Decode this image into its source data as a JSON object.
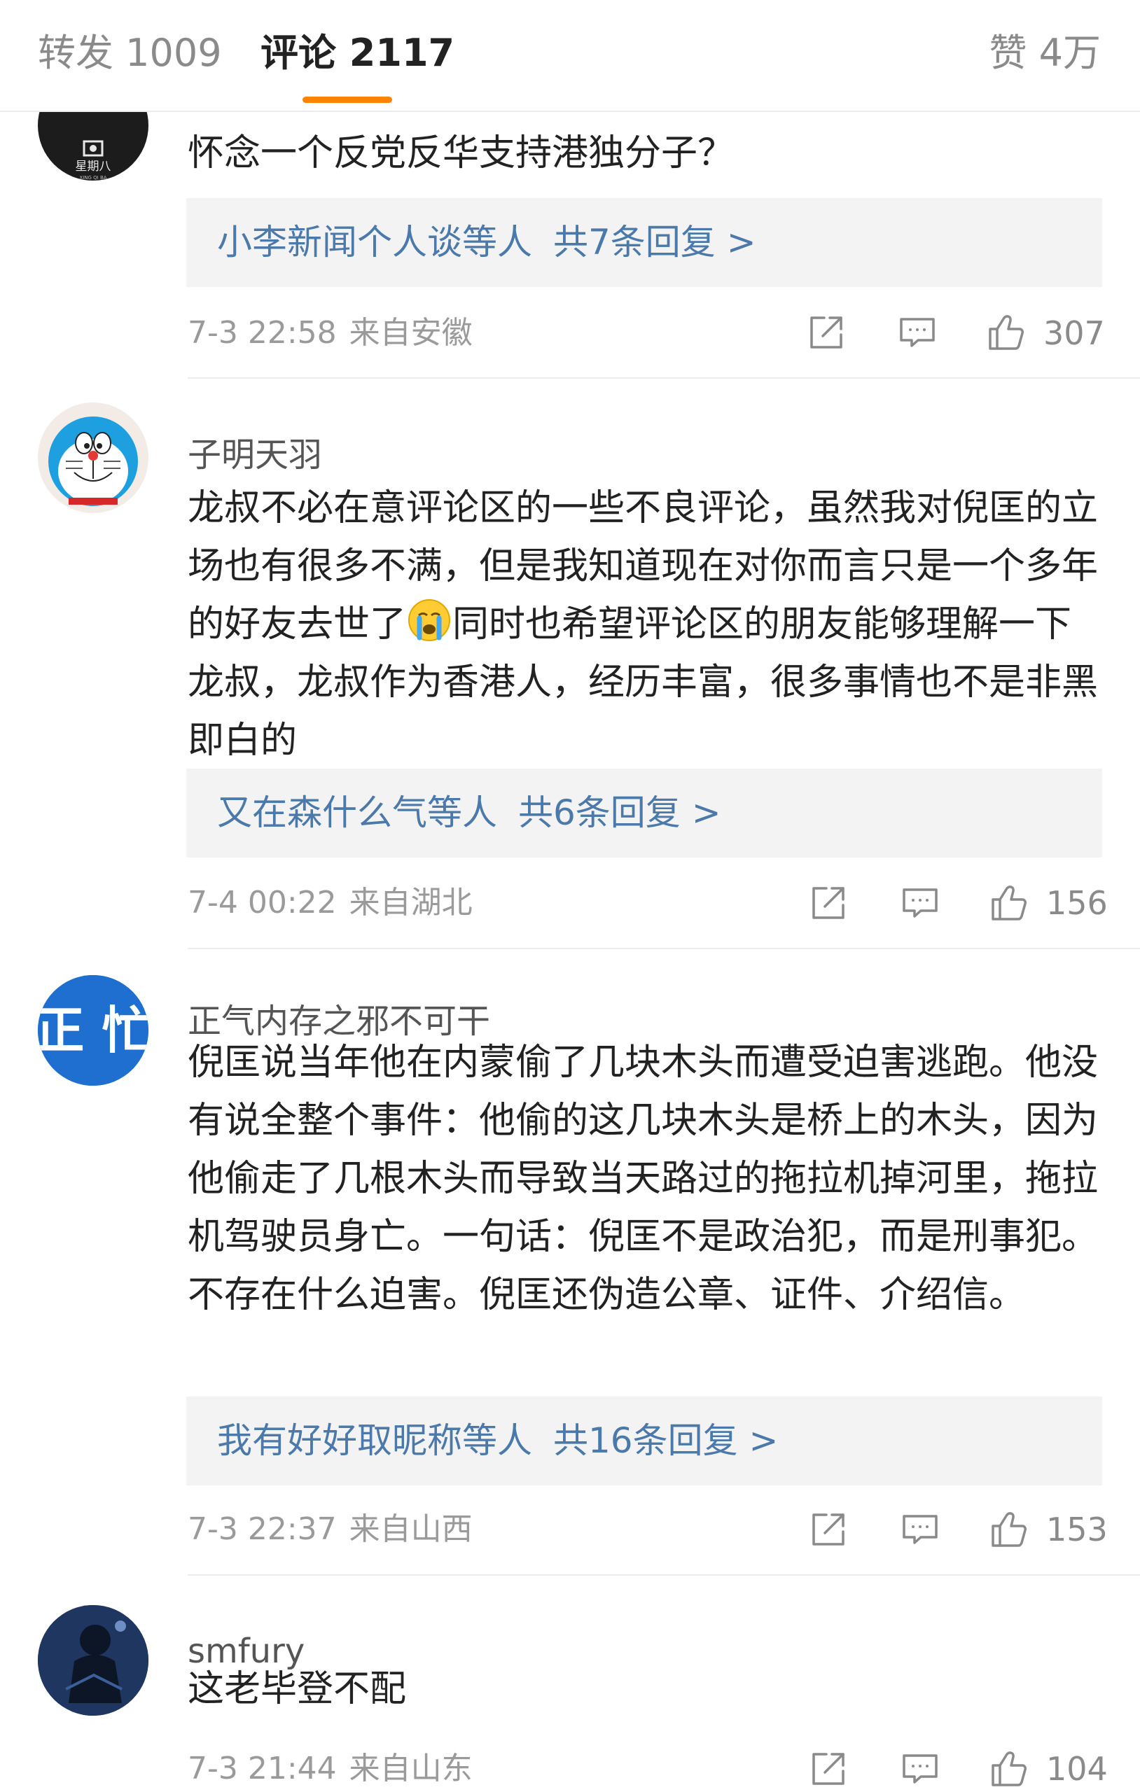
{
  "tabs": {
    "repost_label": "转发 1009",
    "comments_label": "评论 2117",
    "likes_label": "赞 4万",
    "accent_color": "#ff8200"
  },
  "avatars": {
    "a1_text": "星期八",
    "a1_sub": "XING QI BA",
    "a3_text": "正 忙"
  },
  "comments": [
    {
      "username": "",
      "text": "怀念一个反党反华支持港独分子？",
      "reply_names": "小李新闻个人谈等人",
      "reply_count": "共7条回复 >",
      "time": "7-3 22:58",
      "location": "来自安徽",
      "likes": "307"
    },
    {
      "username": "子明天羽",
      "text_a": "龙叔不必在意评论区的一些不良评论，虽然我对倪匡的立场也有很多不满，但是我知道现在对你而言只是一个多年的好友去世了",
      "emoji": "crying-face",
      "text_b": "同时也希望评论区的朋友能够理解一下龙叔，龙叔作为香港人，经历丰富，很多事情也不是非黑即白的",
      "reply_names": "又在森什么气等人",
      "reply_count": "共6条回复 >",
      "time": "7-4 00:22",
      "location": "来自湖北",
      "likes": "156"
    },
    {
      "username": "正气内存之邪不可干",
      "text": "倪匡说当年他在内蒙偷了几块木头而遭受迫害逃跑。他没有说全整个事件：他偷的这几块木头是桥上的木头，因为他偷走了几根木头而导致当天路过的拖拉机掉河里，拖拉机驾驶员身亡。一句话：倪匡不是政治犯，而是刑事犯。不存在什么迫害。倪匡还伪造公章、证件、介绍信。",
      "reply_names": "我有好好取昵称等人",
      "reply_count": "共16条回复 >",
      "time": "7-3 22:37",
      "location": "来自山西",
      "likes": "153"
    },
    {
      "username": "smfury",
      "text": "这老毕登不配",
      "time": "7-3 21:44",
      "location": "来自山东",
      "likes": "104"
    }
  ]
}
